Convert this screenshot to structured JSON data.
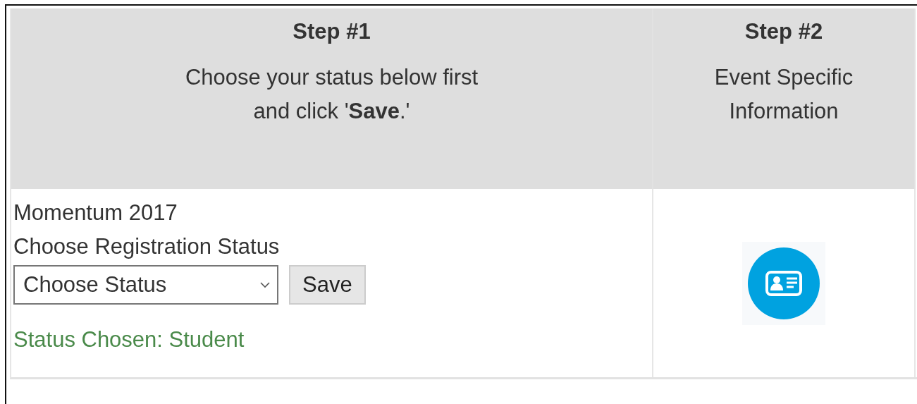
{
  "steps": [
    {
      "title": "Step #1",
      "description_lines": [
        "Choose your status below first",
        "and click '**Save**.'"
      ]
    },
    {
      "title": "Step #2",
      "description_lines": [
        "Event Specific",
        "Information"
      ]
    }
  ],
  "registration": {
    "event": "Momentum 2017",
    "prompt": "Choose Registration Status",
    "status_select": {
      "value": "Choose Status"
    },
    "save_button": "Save",
    "status_message": "Status Chosen: Student"
  },
  "event_info": {
    "kind": "id-card"
  }
}
